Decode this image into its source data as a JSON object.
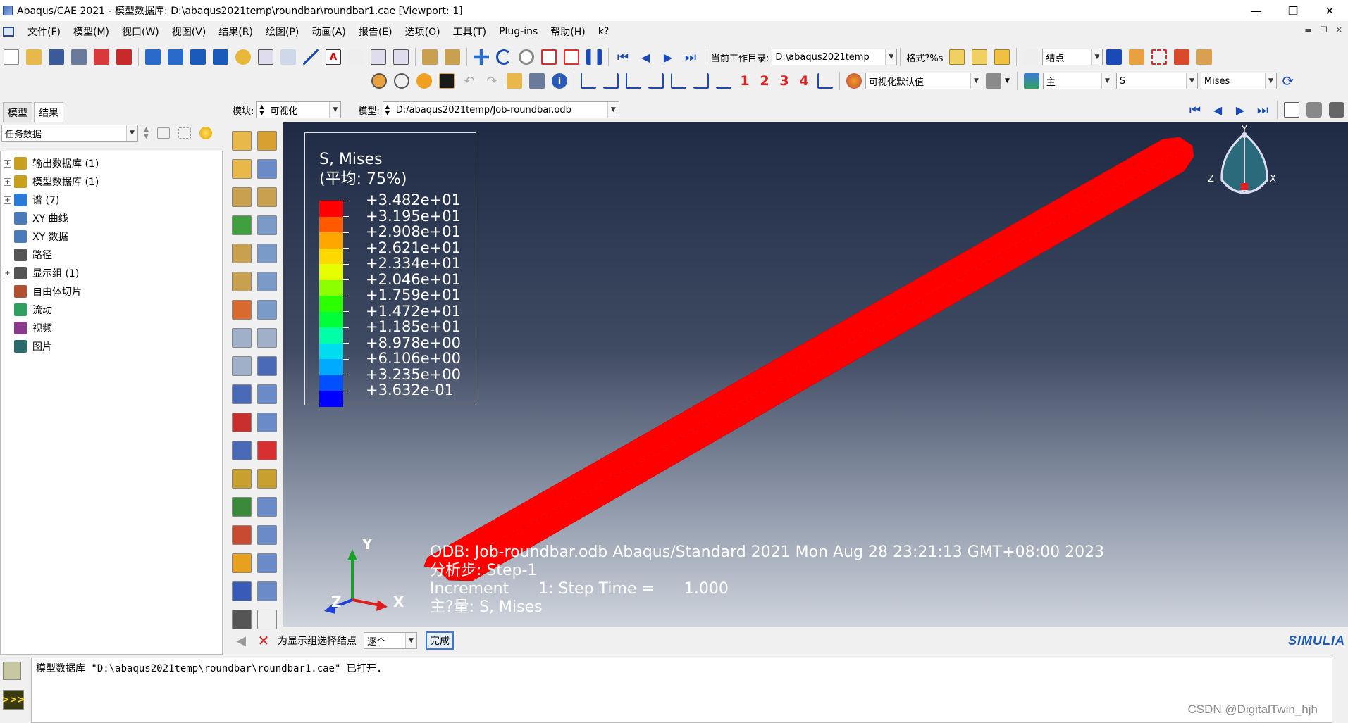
{
  "window": {
    "title": "Abaqus/CAE 2021 - 模型数据库: D:\\abaqus2021temp\\roundbar\\roundbar1.cae [Viewport: 1]",
    "controls": [
      "—",
      "❐",
      "✕"
    ]
  },
  "menu": {
    "items": [
      "文件(F)",
      "模型(M)",
      "视口(W)",
      "视图(V)",
      "结果(R)",
      "绘图(P)",
      "动画(A)",
      "报告(E)",
      "选项(O)",
      "工具(T)",
      "Plug-ins",
      "帮助(H)",
      "k?"
    ]
  },
  "toolbar1": {
    "workdir_label": "当前工作目录:",
    "workdir_value": "D:\\abaqus2021temp",
    "format_label": "格式?%s",
    "node_select": "结点"
  },
  "toolbar2": {
    "numbers": [
      "1",
      "2",
      "3",
      "4"
    ],
    "vis_defaults": "可视化默认值",
    "primary": "主",
    "variable": "S",
    "invariant": "Mises"
  },
  "context": {
    "module_label": "模块:",
    "module_value": "可视化",
    "model_label": "模型:",
    "model_value": "D:/abaqus2021temp/Job-roundbar.odb"
  },
  "leftpanel": {
    "tabs": [
      "模型",
      "结果"
    ],
    "task_select": "任务数据",
    "tree": [
      {
        "label": "输出数据库 (1)",
        "expand": true,
        "color": "#c8a020"
      },
      {
        "label": "模型数据库 (1)",
        "expand": true,
        "color": "#c8a020"
      },
      {
        "label": "谱 (7)",
        "expand": true,
        "color": "#2a7ad8"
      },
      {
        "label": "XY 曲线",
        "expand": false,
        "color": "#4a7ab8"
      },
      {
        "label": "XY 数据",
        "expand": false,
        "color": "#4a7ab8"
      },
      {
        "label": "路径",
        "expand": false,
        "color": "#555555"
      },
      {
        "label": "显示组 (1)",
        "expand": true,
        "color": "#555555"
      },
      {
        "label": "自由体切片",
        "expand": false,
        "color": "#b05030"
      },
      {
        "label": "流动",
        "expand": false,
        "color": "#30a060"
      },
      {
        "label": "视频",
        "expand": false,
        "color": "#8a3a8a"
      },
      {
        "label": "图片",
        "expand": false,
        "color": "#2a6a6a"
      }
    ]
  },
  "legend": {
    "title": "S, Mises",
    "subtitle": "(平均: 75%)",
    "values": [
      "+3.482e+01",
      "+3.195e+01",
      "+2.908e+01",
      "+2.621e+01",
      "+2.334e+01",
      "+2.046e+01",
      "+1.759e+01",
      "+1.472e+01",
      "+1.185e+01",
      "+8.978e+00",
      "+6.106e+00",
      "+3.235e+00",
      "+3.632e-01"
    ],
    "colors": [
      "#ff0000",
      "#ff5a00",
      "#ffa600",
      "#ffd800",
      "#e6ff00",
      "#8cff00",
      "#2bff00",
      "#00ff38",
      "#00ffa6",
      "#00ddee",
      "#00aaff",
      "#0050ff",
      "#0000ff"
    ]
  },
  "viewport_info": {
    "odb_line": "ODB: Job-roundbar.odb    Abaqus/Standard 2021    Mon Aug 28 23:21:13 GMT+08:00 2023",
    "step_line": "分析步: Step-1",
    "increment_line": "Increment      1: Step Time =      1.000",
    "primary_line": "主?量: S, Mises"
  },
  "triad": {
    "x": "X",
    "y": "Y",
    "z": "Z"
  },
  "view_cube": {
    "x": "X",
    "y": "Y",
    "z": "Z"
  },
  "prompt": {
    "text": "为显示组选择结点",
    "mode": "逐个",
    "done": "完成"
  },
  "brand": "SIMULIA",
  "message": "模型数据库 \"D:\\abaqus2021temp\\roundbar\\roundbar1.cae\" 已打开.",
  "watermark": "CSDN @DigitalTwin_hjh"
}
